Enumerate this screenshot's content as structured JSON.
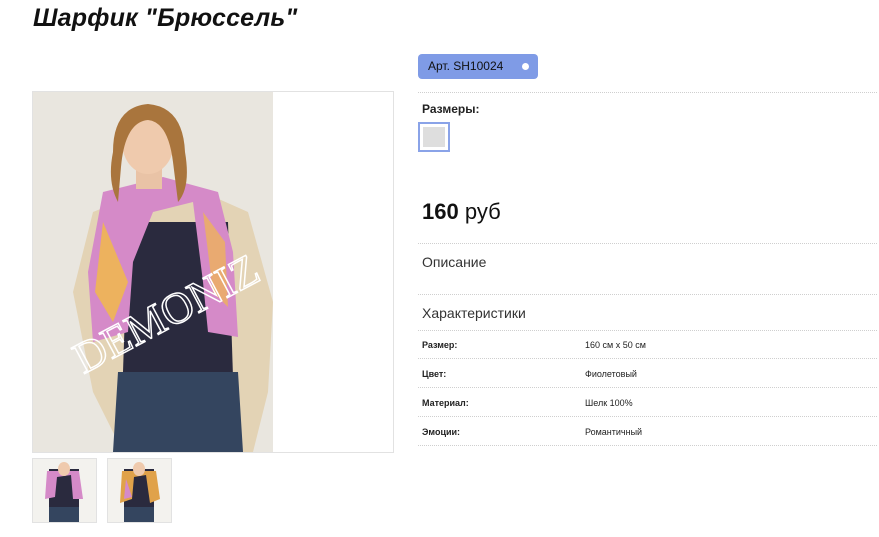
{
  "product": {
    "title": "Шарфик \"Брюссель\"",
    "sku": "Арт. SH10024",
    "sizes_label": "Размеры:",
    "price_amount": "160",
    "price_currency": "руб",
    "description_label": "Описание",
    "specs_label": "Характеристики",
    "specs": [
      {
        "label": "Размер:",
        "value": "160 см x 50 см"
      },
      {
        "label": "Цвет:",
        "value": "Фиолетовый"
      },
      {
        "label": "Материал:",
        "value": "Шелк 100%"
      },
      {
        "label": "Эмоции:",
        "value": "Романтичный"
      }
    ]
  },
  "gallery": {
    "watermark": "DEMONIZ",
    "thumbnails": [
      "thumb-1",
      "thumb-2"
    ]
  },
  "colors": {
    "accent": "#7f9be6",
    "swatch_border": "#8aa3e8",
    "swatch_fill": "#dedede"
  }
}
